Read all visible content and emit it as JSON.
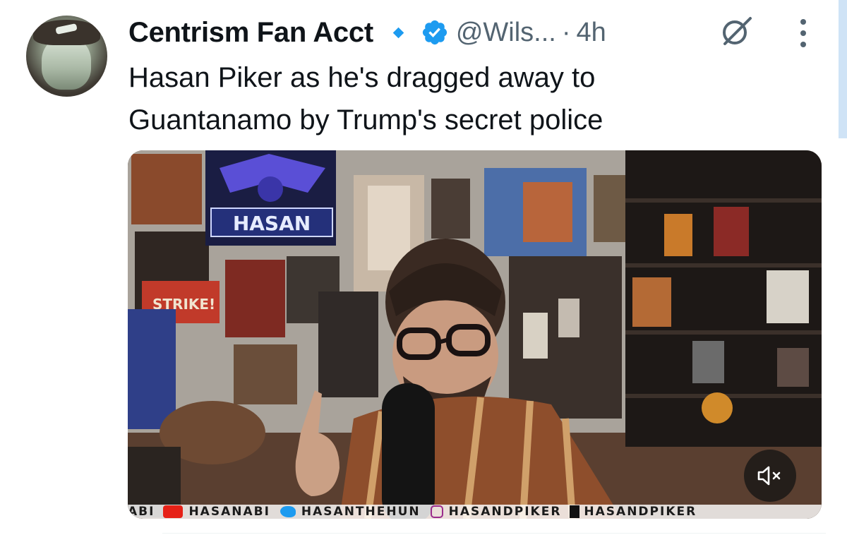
{
  "author": {
    "display_name": "Centrism Fan Acct",
    "handle": "@Wils...",
    "separator": "·",
    "time": "4h",
    "verified": true
  },
  "tweet": {
    "text_line_1": "Hasan Piker as he's dragged away to",
    "text_line_2": "Guantanamo by Trump's secret police"
  },
  "media": {
    "type": "video",
    "muted": true,
    "sign_text": "HASAN",
    "strike_sign": "STRIKE!",
    "socials_text": {
      "s0": "ABI",
      "s1": "HASANABI",
      "s2": "HASANTHEHUN",
      "s3": "HASANDPIKER",
      "s4": "HASANDPIKER"
    }
  },
  "icons": {
    "more": "more-vertical-icon",
    "grok": "grok-icon",
    "verified": "verified-badge-icon",
    "mute": "speaker-muted-icon"
  },
  "colors": {
    "accent": "#1d9bf0",
    "text_primary": "#0f1419",
    "text_secondary": "#536471"
  }
}
